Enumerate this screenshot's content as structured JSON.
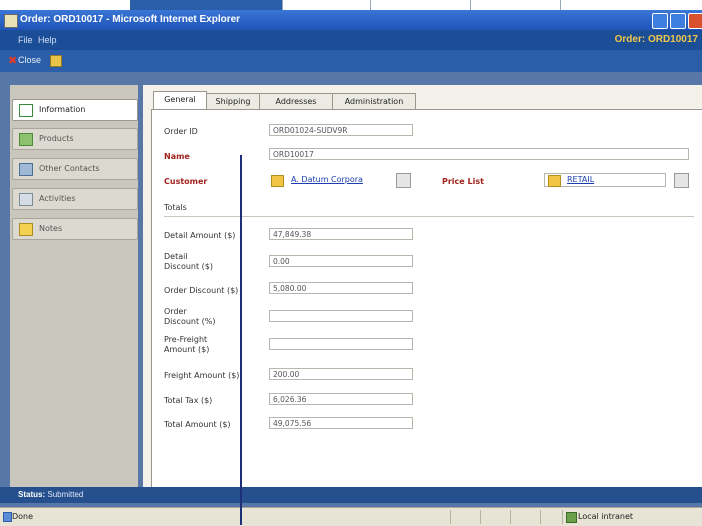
{
  "window": {
    "title": "Order: ORD10017 - Microsoft Internet Explorer"
  },
  "menu": {
    "items": [
      "File",
      "Help"
    ],
    "order_title": "Order: ORD10017"
  },
  "toolbar": {
    "close_label": "Close"
  },
  "nav": {
    "items": [
      {
        "label": "Information",
        "icon": "information-icon"
      },
      {
        "label": "Products",
        "icon": "products-icon"
      },
      {
        "label": "Other Contacts",
        "icon": "contacts-icon"
      },
      {
        "label": "Activities",
        "icon": "activities-icon"
      },
      {
        "label": "Notes",
        "icon": "notes-icon"
      }
    ],
    "selected": "Information"
  },
  "tabs": [
    {
      "label": "General"
    },
    {
      "label": "Shipping"
    },
    {
      "label": "Addresses"
    },
    {
      "label": "Administration"
    }
  ],
  "form": {
    "order_id": {
      "label": "Order ID",
      "value": "ORD01024-SUDV9R"
    },
    "name": {
      "label": "Name",
      "value": "ORD10017"
    },
    "customer": {
      "label": "Customer",
      "value": "A. Datum Corpora"
    },
    "price_list": {
      "label": "Price List",
      "value": "RETAIL"
    }
  },
  "totals": {
    "header": "Totals",
    "rows": [
      {
        "label": "Detail Amount ($)",
        "value": "47,849.38"
      },
      {
        "label": "Detail Discount ($)",
        "value": "0.00"
      },
      {
        "label": "Order Discount ($)",
        "value": "5,080.00"
      },
      {
        "label": "Order Discount (%)",
        "value": ""
      },
      {
        "label": "Pre-Freight Amount ($)",
        "value": ""
      },
      {
        "label": "Freight Amount ($)",
        "value": "200.00"
      },
      {
        "label": "Total Tax ($)",
        "value": "6,026.36"
      },
      {
        "label": "Total Amount ($)",
        "value": "49,075.56"
      }
    ]
  },
  "status": {
    "label": "Status:",
    "value": "Submitted"
  },
  "browser_status": {
    "done": "Done",
    "zone": "Local intranet"
  },
  "colors": {
    "title_bar": "#1f54b8",
    "frame": "#5677a8",
    "required_label": "#a2231e",
    "order_title": "#f0c84a",
    "link": "#1b3fb0"
  }
}
